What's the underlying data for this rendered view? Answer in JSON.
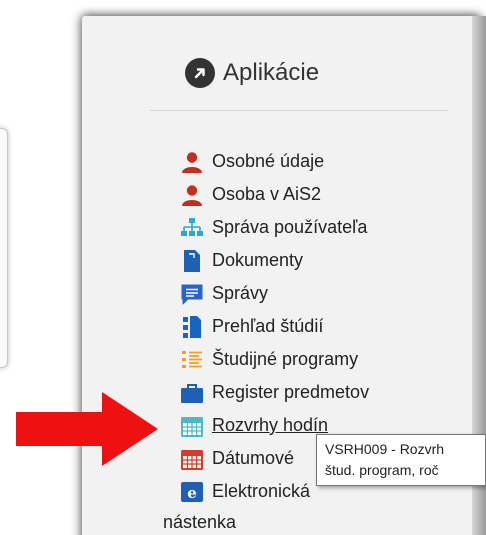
{
  "header": {
    "title": "Aplikácie",
    "icon": "arrow-up-right-circle-icon"
  },
  "menu": {
    "items": [
      {
        "label": "Osobné údaje",
        "icon": "user-icon",
        "color": "#c0301c"
      },
      {
        "label": "Osoba v AiS2",
        "icon": "user-icon",
        "color": "#c0301c"
      },
      {
        "label": "Správa používateľa",
        "icon": "sitemap-icon",
        "color": "#2aa9d2"
      },
      {
        "label": "Dokumenty",
        "icon": "document-icon",
        "color": "#1f5fb4"
      },
      {
        "label": "Správy",
        "icon": "message-icon",
        "color": "#2b64c8"
      },
      {
        "label": "Prehľad štúdií",
        "icon": "list-icon",
        "color": "#1565c0"
      },
      {
        "label": "Študijné programy",
        "icon": "list-icon",
        "color": "#f0a020"
      },
      {
        "label": "Register predmetov",
        "icon": "briefcase-icon",
        "color": "#1f5fb4"
      },
      {
        "label": "Rozvrhy hodín",
        "icon": "calendar-icon",
        "color": "#4ab8c8"
      },
      {
        "label": "Dátumové",
        "icon": "calendar-icon",
        "color": "#d43c28"
      },
      {
        "label": "Elektronická",
        "icon": "e-icon",
        "color": "#1f5fb4"
      }
    ],
    "continuation": "nástenka"
  },
  "tooltip": {
    "line1": "VSRH009 - Rozvrh",
    "line2": "štud. program, roč"
  },
  "arrow": {
    "icon": "red-arrow-icon",
    "color": "#ee1111"
  }
}
